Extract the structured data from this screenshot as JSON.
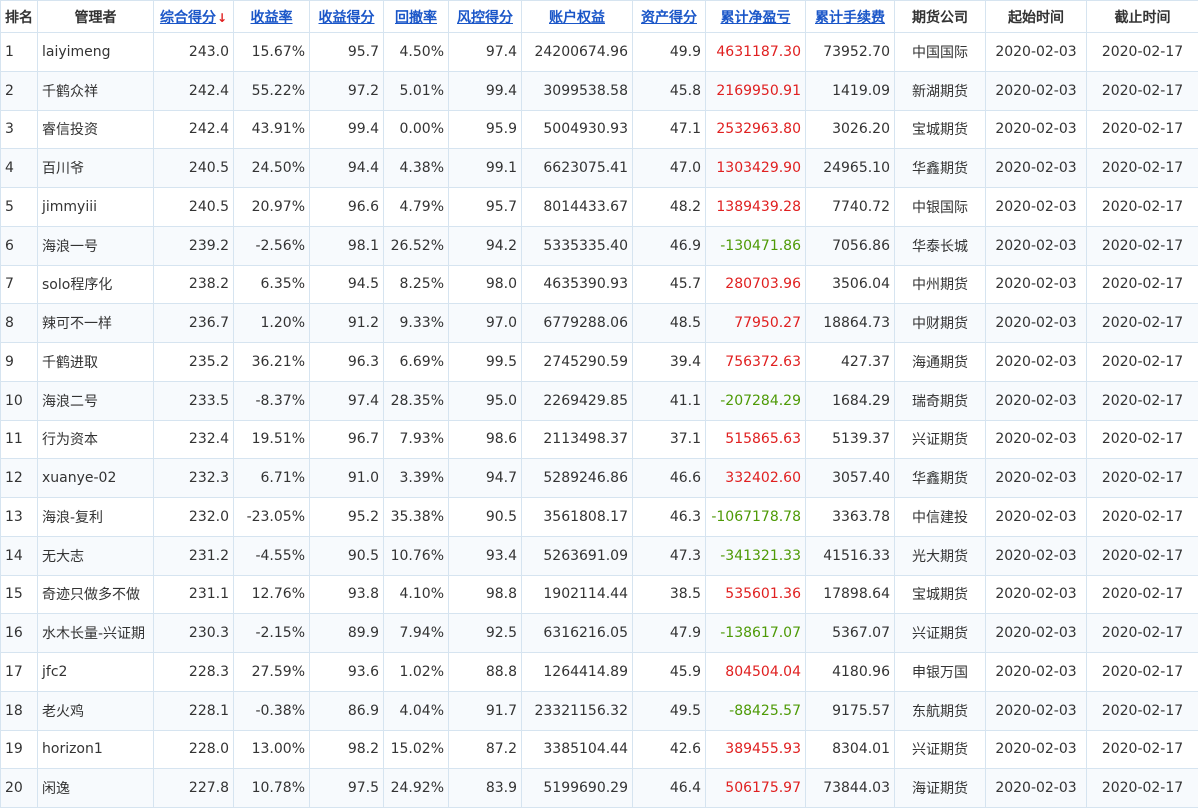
{
  "colors": {
    "accent_link": "#1a56c8",
    "positive": "#e02020",
    "negative": "#4e9a06",
    "border": "#d6e4f0"
  },
  "headers": [
    {
      "key": "rank",
      "label": "排名",
      "sortable": false
    },
    {
      "key": "manager",
      "label": "管理者",
      "sortable": false
    },
    {
      "key": "score",
      "label": "综合得分",
      "sortable": true,
      "sort_indicator": "↓"
    },
    {
      "key": "return",
      "label": "收益率",
      "sortable": true
    },
    {
      "key": "return_score",
      "label": "收益得分",
      "sortable": true
    },
    {
      "key": "drawdown",
      "label": "回撤率",
      "sortable": true
    },
    {
      "key": "risk_score",
      "label": "风控得分",
      "sortable": true
    },
    {
      "key": "equity",
      "label": "账户权益",
      "sortable": true
    },
    {
      "key": "asset_score",
      "label": "资产得分",
      "sortable": true
    },
    {
      "key": "pnl",
      "label": "累计净盈亏",
      "sortable": true
    },
    {
      "key": "fees",
      "label": "累计手续费",
      "sortable": true
    },
    {
      "key": "company",
      "label": "期货公司",
      "sortable": false
    },
    {
      "key": "start",
      "label": "起始时间",
      "sortable": false
    },
    {
      "key": "end",
      "label": "截止时间",
      "sortable": false
    }
  ],
  "rows": [
    {
      "rank": "1",
      "manager": "laiyimeng",
      "score": "243.0",
      "return": "15.67%",
      "return_score": "95.7",
      "drawdown": "4.50%",
      "risk_score": "97.4",
      "equity": "24200674.96",
      "asset_score": "49.9",
      "pnl": "4631187.30",
      "fees": "73952.70",
      "company": "中国国际",
      "start": "2020-02-03",
      "end": "2020-02-17"
    },
    {
      "rank": "2",
      "manager": "千鹤众祥",
      "score": "242.4",
      "return": "55.22%",
      "return_score": "97.2",
      "drawdown": "5.01%",
      "risk_score": "99.4",
      "equity": "3099538.58",
      "asset_score": "45.8",
      "pnl": "2169950.91",
      "fees": "1419.09",
      "company": "新湖期货",
      "start": "2020-02-03",
      "end": "2020-02-17"
    },
    {
      "rank": "3",
      "manager": "睿信投资",
      "score": "242.4",
      "return": "43.91%",
      "return_score": "99.4",
      "drawdown": "0.00%",
      "risk_score": "95.9",
      "equity": "5004930.93",
      "asset_score": "47.1",
      "pnl": "2532963.80",
      "fees": "3026.20",
      "company": "宝城期货",
      "start": "2020-02-03",
      "end": "2020-02-17"
    },
    {
      "rank": "4",
      "manager": "百川爷",
      "score": "240.5",
      "return": "24.50%",
      "return_score": "94.4",
      "drawdown": "4.38%",
      "risk_score": "99.1",
      "equity": "6623075.41",
      "asset_score": "47.0",
      "pnl": "1303429.90",
      "fees": "24965.10",
      "company": "华鑫期货",
      "start": "2020-02-03",
      "end": "2020-02-17"
    },
    {
      "rank": "5",
      "manager": "jimmyiii",
      "score": "240.5",
      "return": "20.97%",
      "return_score": "96.6",
      "drawdown": "4.79%",
      "risk_score": "95.7",
      "equity": "8014433.67",
      "asset_score": "48.2",
      "pnl": "1389439.28",
      "fees": "7740.72",
      "company": "中银国际",
      "start": "2020-02-03",
      "end": "2020-02-17"
    },
    {
      "rank": "6",
      "manager": "海浪一号",
      "score": "239.2",
      "return": "-2.56%",
      "return_score": "98.1",
      "drawdown": "26.52%",
      "risk_score": "94.2",
      "equity": "5335335.40",
      "asset_score": "46.9",
      "pnl": "-130471.86",
      "fees": "7056.86",
      "company": "华泰长城",
      "start": "2020-02-03",
      "end": "2020-02-17"
    },
    {
      "rank": "7",
      "manager": "solo程序化",
      "score": "238.2",
      "return": "6.35%",
      "return_score": "94.5",
      "drawdown": "8.25%",
      "risk_score": "98.0",
      "equity": "4635390.93",
      "asset_score": "45.7",
      "pnl": "280703.96",
      "fees": "3506.04",
      "company": "中州期货",
      "start": "2020-02-03",
      "end": "2020-02-17"
    },
    {
      "rank": "8",
      "manager": "辣可不一样",
      "score": "236.7",
      "return": "1.20%",
      "return_score": "91.2",
      "drawdown": "9.33%",
      "risk_score": "97.0",
      "equity": "6779288.06",
      "asset_score": "48.5",
      "pnl": "77950.27",
      "fees": "18864.73",
      "company": "中财期货",
      "start": "2020-02-03",
      "end": "2020-02-17"
    },
    {
      "rank": "9",
      "manager": "千鹤进取",
      "score": "235.2",
      "return": "36.21%",
      "return_score": "96.3",
      "drawdown": "6.69%",
      "risk_score": "99.5",
      "equity": "2745290.59",
      "asset_score": "39.4",
      "pnl": "756372.63",
      "fees": "427.37",
      "company": "海通期货",
      "start": "2020-02-03",
      "end": "2020-02-17"
    },
    {
      "rank": "10",
      "manager": "海浪二号",
      "score": "233.5",
      "return": "-8.37%",
      "return_score": "97.4",
      "drawdown": "28.35%",
      "risk_score": "95.0",
      "equity": "2269429.85",
      "asset_score": "41.1",
      "pnl": "-207284.29",
      "fees": "1684.29",
      "company": "瑞奇期货",
      "start": "2020-02-03",
      "end": "2020-02-17"
    },
    {
      "rank": "11",
      "manager": "行为资本",
      "score": "232.4",
      "return": "19.51%",
      "return_score": "96.7",
      "drawdown": "7.93%",
      "risk_score": "98.6",
      "equity": "2113498.37",
      "asset_score": "37.1",
      "pnl": "515865.63",
      "fees": "5139.37",
      "company": "兴证期货",
      "start": "2020-02-03",
      "end": "2020-02-17"
    },
    {
      "rank": "12",
      "manager": "xuanye-02",
      "score": "232.3",
      "return": "6.71%",
      "return_score": "91.0",
      "drawdown": "3.39%",
      "risk_score": "94.7",
      "equity": "5289246.86",
      "asset_score": "46.6",
      "pnl": "332402.60",
      "fees": "3057.40",
      "company": "华鑫期货",
      "start": "2020-02-03",
      "end": "2020-02-17"
    },
    {
      "rank": "13",
      "manager": "海浪-复利",
      "score": "232.0",
      "return": "-23.05%",
      "return_score": "95.2",
      "drawdown": "35.38%",
      "risk_score": "90.5",
      "equity": "3561808.17",
      "asset_score": "46.3",
      "pnl": "-1067178.78",
      "fees": "3363.78",
      "company": "中信建投",
      "start": "2020-02-03",
      "end": "2020-02-17"
    },
    {
      "rank": "14",
      "manager": "无大志",
      "score": "231.2",
      "return": "-4.55%",
      "return_score": "90.5",
      "drawdown": "10.76%",
      "risk_score": "93.4",
      "equity": "5263691.09",
      "asset_score": "47.3",
      "pnl": "-341321.33",
      "fees": "41516.33",
      "company": "光大期货",
      "start": "2020-02-03",
      "end": "2020-02-17"
    },
    {
      "rank": "15",
      "manager": "奇迹只做多不做",
      "score": "231.1",
      "return": "12.76%",
      "return_score": "93.8",
      "drawdown": "4.10%",
      "risk_score": "98.8",
      "equity": "1902114.44",
      "asset_score": "38.5",
      "pnl": "535601.36",
      "fees": "17898.64",
      "company": "宝城期货",
      "start": "2020-02-03",
      "end": "2020-02-17"
    },
    {
      "rank": "16",
      "manager": "水木长量-兴证期",
      "score": "230.3",
      "return": "-2.15%",
      "return_score": "89.9",
      "drawdown": "7.94%",
      "risk_score": "92.5",
      "equity": "6316216.05",
      "asset_score": "47.9",
      "pnl": "-138617.07",
      "fees": "5367.07",
      "company": "兴证期货",
      "start": "2020-02-03",
      "end": "2020-02-17"
    },
    {
      "rank": "17",
      "manager": "jfc2",
      "score": "228.3",
      "return": "27.59%",
      "return_score": "93.6",
      "drawdown": "1.02%",
      "risk_score": "88.8",
      "equity": "1264414.89",
      "asset_score": "45.9",
      "pnl": "804504.04",
      "fees": "4180.96",
      "company": "申银万国",
      "start": "2020-02-03",
      "end": "2020-02-17"
    },
    {
      "rank": "18",
      "manager": "老火鸡",
      "score": "228.1",
      "return": "-0.38%",
      "return_score": "86.9",
      "drawdown": "4.04%",
      "risk_score": "91.7",
      "equity": "23321156.32",
      "asset_score": "49.5",
      "pnl": "-88425.57",
      "fees": "9175.57",
      "company": "东航期货",
      "start": "2020-02-03",
      "end": "2020-02-17"
    },
    {
      "rank": "19",
      "manager": "horizon1",
      "score": "228.0",
      "return": "13.00%",
      "return_score": "98.2",
      "drawdown": "15.02%",
      "risk_score": "87.2",
      "equity": "3385104.44",
      "asset_score": "42.6",
      "pnl": "389455.93",
      "fees": "8304.01",
      "company": "兴证期货",
      "start": "2020-02-03",
      "end": "2020-02-17"
    },
    {
      "rank": "20",
      "manager": "闲逸",
      "score": "227.8",
      "return": "10.78%",
      "return_score": "97.5",
      "drawdown": "24.92%",
      "risk_score": "83.9",
      "equity": "5199690.29",
      "asset_score": "46.4",
      "pnl": "506175.97",
      "fees": "73844.03",
      "company": "海证期货",
      "start": "2020-02-03",
      "end": "2020-02-17"
    }
  ]
}
